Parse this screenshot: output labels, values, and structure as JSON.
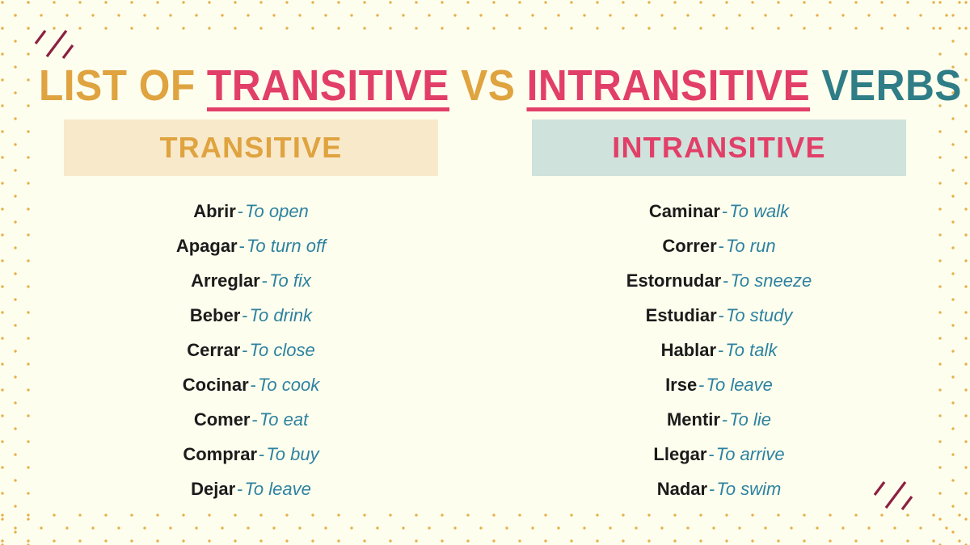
{
  "title": {
    "part1": "LIST OF",
    "part2": "TRANSITIVE",
    "part3": "VS",
    "part4": "INTRANSITIVE",
    "part5": "VERBS"
  },
  "colors": {
    "background": "#fefeee",
    "orange": "#dfa33f",
    "pink": "#e23f68",
    "teal": "#2f7d86",
    "definition_blue": "#2d82a0",
    "transitive_header_bg": "#f9e9cb",
    "intransitive_header_bg": "#cfe2dc",
    "dot_ornament": "#e6b04a",
    "slash_ornament": "#8c2042"
  },
  "columns": [
    {
      "header": "TRANSITIVE",
      "items": [
        {
          "term": "Abrir",
          "dash": "-",
          "definition": "To open"
        },
        {
          "term": "Apagar",
          "dash": "-",
          "definition": "To turn off"
        },
        {
          "term": "Arreglar",
          "dash": "-",
          "definition": "To fix"
        },
        {
          "term": "Beber",
          "dash": "-",
          "definition": "To drink"
        },
        {
          "term": "Cerrar",
          "dash": "-",
          "definition": "To close"
        },
        {
          "term": "Cocinar",
          "dash": "-",
          "definition": "To cook"
        },
        {
          "term": "Comer",
          "dash": "-",
          "definition": "To eat"
        },
        {
          "term": "Comprar",
          "dash": "-",
          "definition": "To buy"
        },
        {
          "term": "Dejar",
          "dash": "-",
          "definition": "To leave"
        }
      ]
    },
    {
      "header": "INTRANSITIVE",
      "items": [
        {
          "term": "Caminar",
          "dash": "-",
          "definition": "To walk"
        },
        {
          "term": "Correr",
          "dash": "-",
          "definition": "To run"
        },
        {
          "term": "Estornudar",
          "dash": "-",
          "definition": "To sneeze"
        },
        {
          "term": "Estudiar",
          "dash": "-",
          "definition": "To study"
        },
        {
          "term": "Hablar",
          "dash": "-",
          "definition": "To talk"
        },
        {
          "term": "Irse",
          "dash": "-",
          "definition": "To leave"
        },
        {
          "term": "Mentir",
          "dash": "-",
          "definition": "To lie"
        },
        {
          "term": "Llegar",
          "dash": "-",
          "definition": "To arrive"
        },
        {
          "term": "Nadar",
          "dash": "-",
          "definition": "To swim"
        }
      ]
    }
  ],
  "ornaments": {
    "top_left_slashes": "slash-ornament",
    "bottom_right_slashes": "slash-ornament",
    "border": "dotted-border"
  }
}
